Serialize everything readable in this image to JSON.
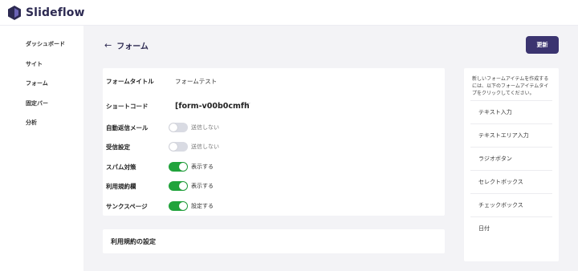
{
  "app": {
    "name": "Slideflow"
  },
  "sidebar": {
    "items": [
      {
        "label": "ダッシュボード"
      },
      {
        "label": "サイト"
      },
      {
        "label": "フォーム"
      },
      {
        "label": "固定バー"
      },
      {
        "label": "分析"
      }
    ]
  },
  "header": {
    "back_icon": "arrow-left-icon",
    "title": "フォーム",
    "update_label": "更新"
  },
  "form": {
    "title_label": "フォームタイトル",
    "title_value": "フォームテスト",
    "shortcode_label": "ショートコード",
    "shortcode_value": "[form-v00b0cmfh",
    "toggles": [
      {
        "label": "自動返信メール",
        "state": false,
        "text": "送信しない"
      },
      {
        "label": "受信設定",
        "state": false,
        "text": "送信しない"
      },
      {
        "label": "スパム対策",
        "state": true,
        "text": "表示する"
      },
      {
        "label": "利用規約欄",
        "state": true,
        "text": "表示する"
      },
      {
        "label": "サンクスページ",
        "state": true,
        "text": "設定する"
      }
    ]
  },
  "terms_section": {
    "title": "利用規約の設定"
  },
  "panel": {
    "description": "新しいフォームアイテムを作成するには、以下のフォームアイテムタイプをクリックしてください。",
    "items": [
      {
        "label": "テキスト入力"
      },
      {
        "label": "テキストエリア入力"
      },
      {
        "label": "ラジオボタン"
      },
      {
        "label": "セレクトボックス"
      },
      {
        "label": "チェックボックス"
      },
      {
        "label": "日付"
      }
    ]
  },
  "colors": {
    "brand": "#2d2a52",
    "button": "#3b3470",
    "toggle_on": "#21a33c",
    "toggle_off": "#d9dbe3"
  }
}
